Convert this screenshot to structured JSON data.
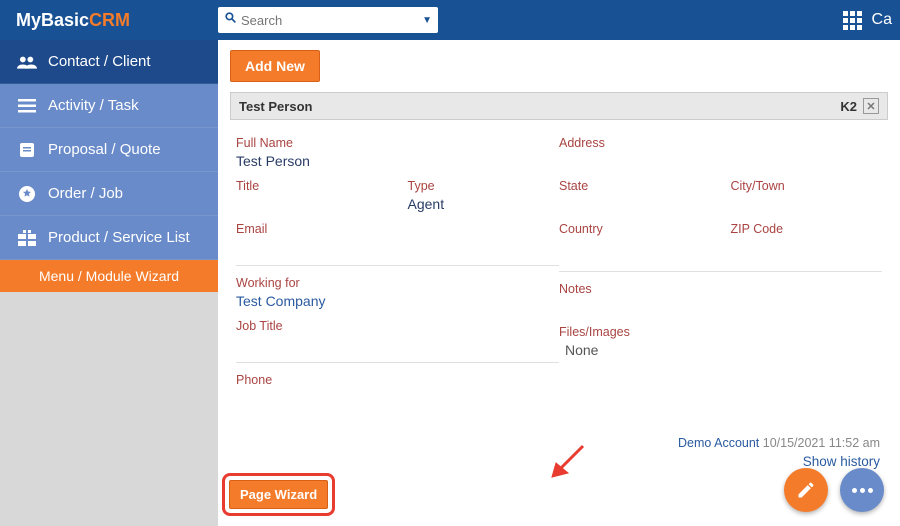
{
  "brand": {
    "part1": "MyBasic",
    "part2": "CRM"
  },
  "search": {
    "placeholder": "Search"
  },
  "toprightText": "Ca",
  "sidebar": {
    "items": [
      {
        "label": "Contact / Client"
      },
      {
        "label": "Activity / Task"
      },
      {
        "label": "Proposal / Quote"
      },
      {
        "label": "Order / Job"
      },
      {
        "label": "Product / Service List"
      }
    ],
    "wizard": "Menu / Module Wizard"
  },
  "buttons": {
    "addNew": "Add New",
    "pageWizard": "Page Wizard"
  },
  "record": {
    "header": "Test Person",
    "code": "K2"
  },
  "labels": {
    "fullName": "Full Name",
    "title": "Title",
    "type": "Type",
    "email": "Email",
    "workingFor": "Working for",
    "jobTitle": "Job Title",
    "phone": "Phone",
    "address": "Address",
    "state": "State",
    "cityTown": "City/Town",
    "country": "Country",
    "zip": "ZIP Code",
    "notes": "Notes",
    "files": "Files/Images"
  },
  "values": {
    "fullName": "Test Person",
    "title": "",
    "type": "Agent",
    "email": "",
    "workingFor": "Test Company",
    "jobTitle": "",
    "phone": "",
    "address": "",
    "state": "",
    "cityTown": "",
    "country": "",
    "zip": "",
    "notes": "",
    "files": "None"
  },
  "meta": {
    "account": "Demo Account",
    "timestamp": "10/15/2021 11:52 am",
    "history": "Show history"
  }
}
